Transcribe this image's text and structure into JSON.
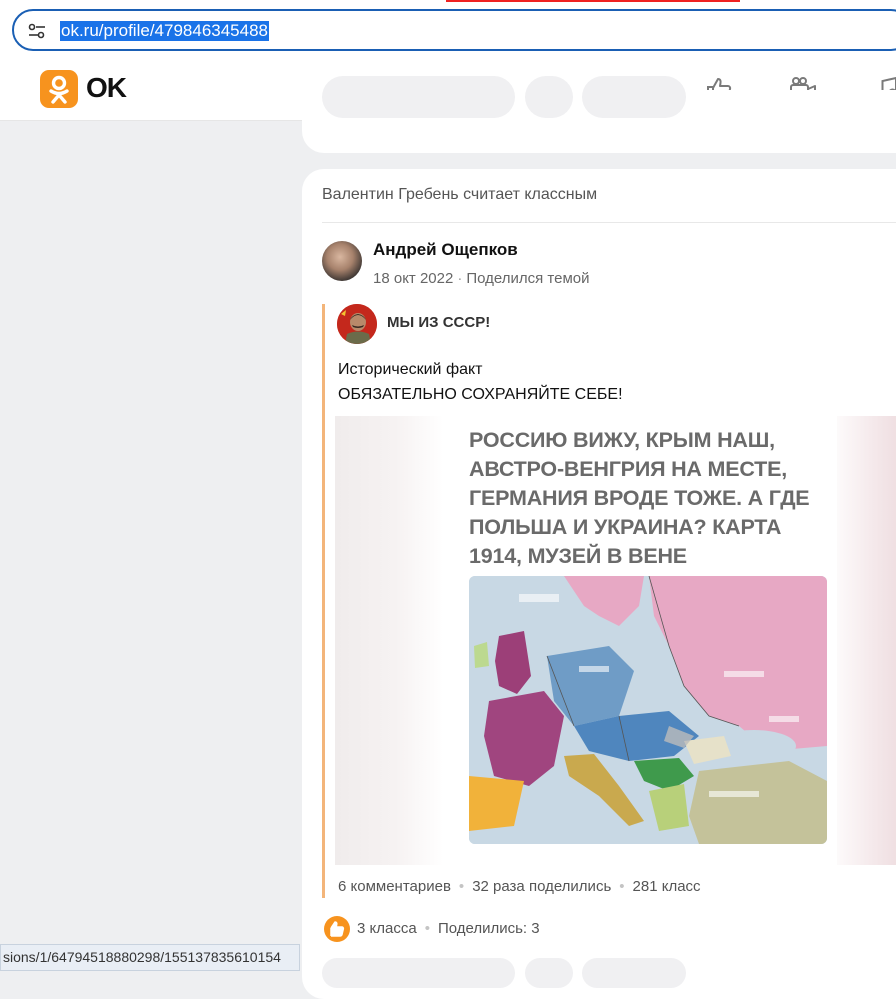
{
  "browser": {
    "url": "ok.ru/profile/479846345488",
    "status_url": "sions/1/64794518880298/155137835610154"
  },
  "site": {
    "logo_text": "OK",
    "brand_color": "#f7931e",
    "nav_icons": [
      "mail-icon",
      "chat-icon",
      "bell-icon",
      "guests-icon",
      "like-icon",
      "video-icon",
      "music-icon"
    ]
  },
  "post": {
    "liked_by": "Валентин Гребень считает классным",
    "author": "Андрей Ощепков",
    "date": "18 окт 2022",
    "action": "Поделился темой",
    "group_name": "МЫ ИЗ СССР!",
    "text_line1": "Исторический факт",
    "text_line2": "ОБЯЗАТЕЛЬНО СОХРАНЯЙТЕ СЕБЕ!",
    "image_title": "РОССИЮ ВИЖУ, КРЫМ НАШ, АВСТРО-ВЕНГРИЯ НА МЕСТЕ, ГЕРМАНИЯ ВРОДЕ ТОЖЕ. А ГДЕ ПОЛЬША И УКРАИНА? КАРТА 1914, МУЗЕЙ В ВЕНЕ",
    "comments": "6 комментариев",
    "shares": "32 раза поделились",
    "likes_inner": "281 класс",
    "likes": "3 класса",
    "shared": "Поделились: 3"
  }
}
